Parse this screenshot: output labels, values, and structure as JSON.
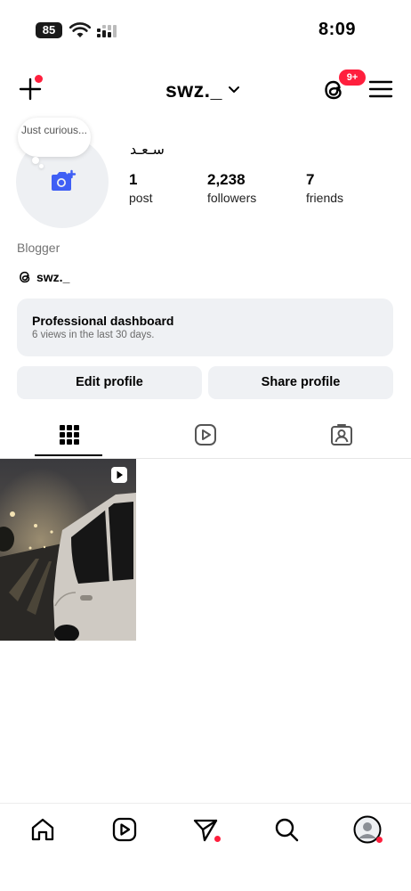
{
  "status_bar": {
    "battery": "85",
    "time": "8:09"
  },
  "header": {
    "username": "swz._",
    "notification_badge": "9+"
  },
  "profile": {
    "note_bubble": "Just curious...",
    "display_name": "سـعـد",
    "stats": [
      {
        "value": "1",
        "label": "post"
      },
      {
        "value": "2,238",
        "label": "followers"
      },
      {
        "value": "7",
        "label": "friends"
      }
    ],
    "category": "Blogger",
    "threads_handle": "swz._"
  },
  "dashboard": {
    "title": "Professional dashboard",
    "subtitle": "6 views in the last 30 days."
  },
  "actions": {
    "edit_profile": "Edit profile",
    "share_profile": "Share profile"
  },
  "tabs": [
    {
      "name": "grid-icon",
      "active": true
    },
    {
      "name": "reels-icon",
      "active": false
    },
    {
      "name": "tagged-icon",
      "active": false
    }
  ],
  "posts": [
    {
      "type": "reel",
      "content": "night street with car in rain"
    }
  ],
  "bottom_nav": [
    "home-icon",
    "reels-icon",
    "direct-icon",
    "search-icon",
    "profile-icon"
  ],
  "colors": {
    "accent_red": "#ff1f3d",
    "camera_blue": "#3f5ff5",
    "surface": "#eff1f4"
  }
}
